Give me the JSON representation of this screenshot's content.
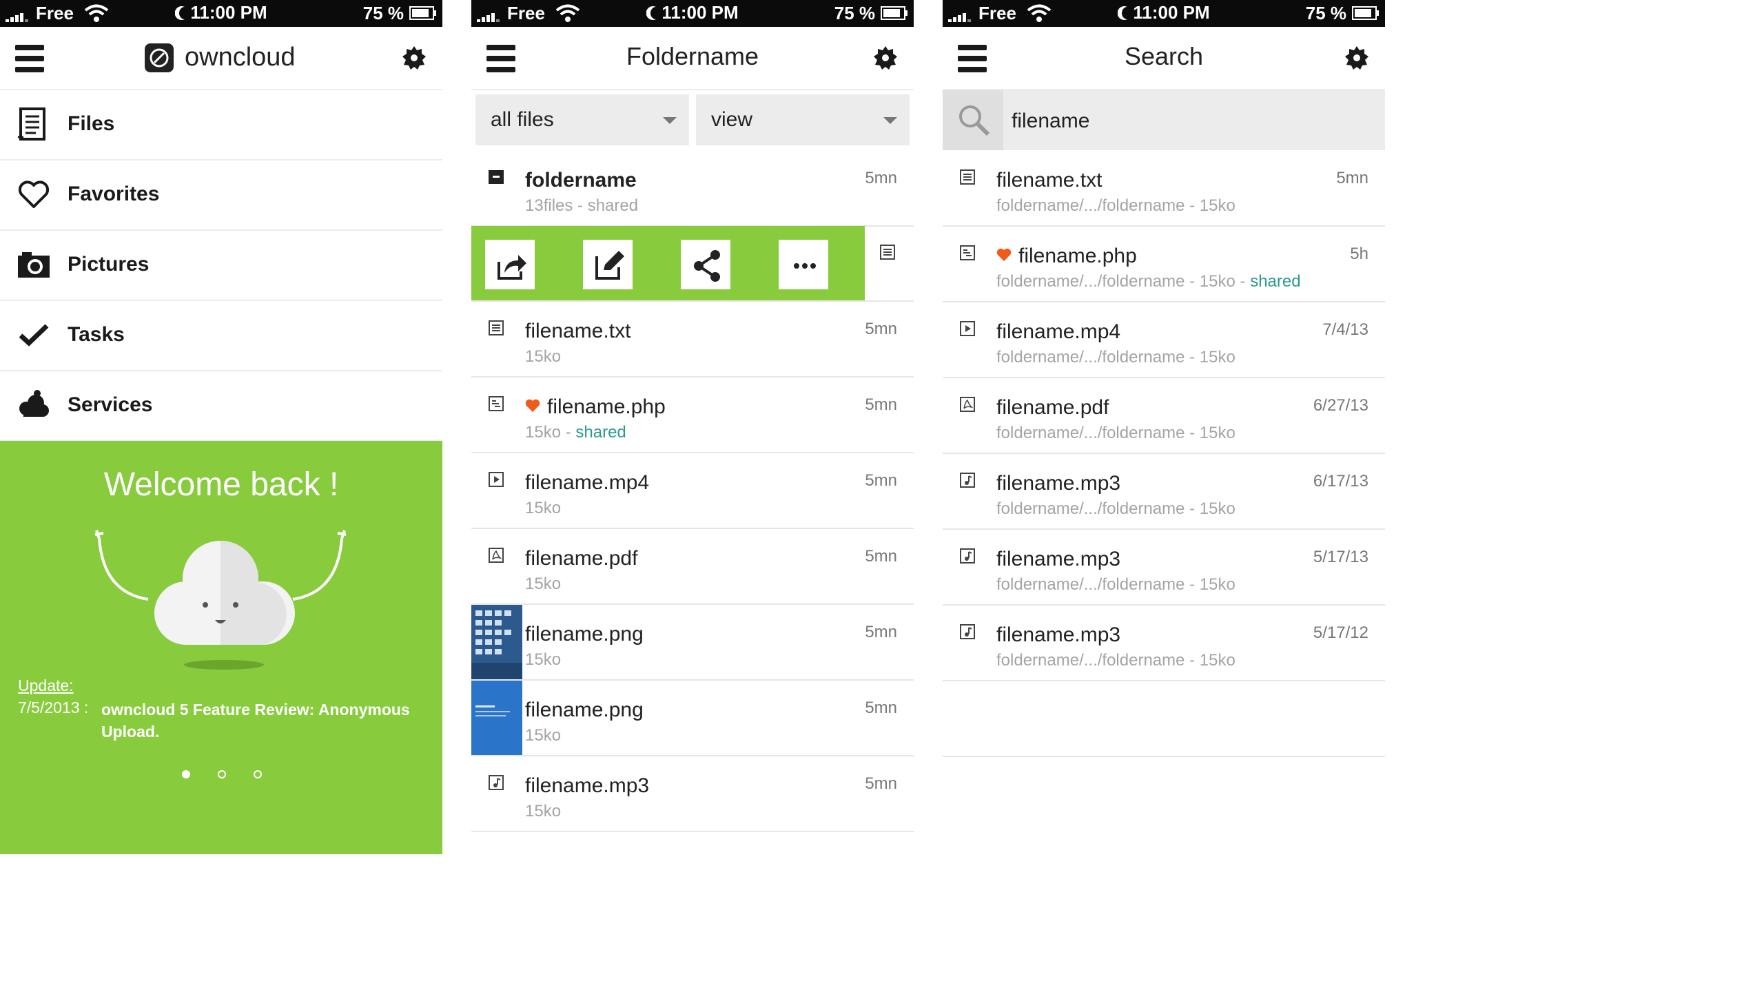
{
  "status_bar": {
    "carrier": "Free",
    "time": "11:00 PM",
    "battery": "75 %"
  },
  "screen1": {
    "logo_text": "owncloud",
    "nav": [
      {
        "label": "Files",
        "icon": "document-list-icon"
      },
      {
        "label": "Favorites",
        "icon": "heart-outline-icon"
      },
      {
        "label": "Pictures",
        "icon": "camera-icon"
      },
      {
        "label": "Tasks",
        "icon": "checkmark-icon"
      },
      {
        "label": "Services",
        "icon": "cloud-services-icon"
      }
    ],
    "welcome": {
      "title": "Welcome back !",
      "update_label": "Update:",
      "update_date": "7/5/2013 :",
      "update_text": "owncloud 5 Feature Review: Anonymous Upload.",
      "pages": 3,
      "active_page": 1
    }
  },
  "screen2": {
    "title": "Foldername",
    "filter": {
      "left": "all files",
      "right": "view"
    },
    "folder": {
      "name": "foldername",
      "meta": "13files - shared",
      "time": "5mn"
    },
    "actions": [
      "share-out-icon",
      "edit-icon",
      "share-icon",
      "more-icon"
    ],
    "files": [
      {
        "name": "filename.txt",
        "meta": "15ko",
        "shared": "",
        "time": "5mn",
        "icon": "text-file-icon"
      },
      {
        "name": "filename.php",
        "meta": "15ko - ",
        "shared": "shared",
        "time": "5mn",
        "icon": "code-file-icon",
        "favorite": true
      },
      {
        "name": "filename.mp4",
        "meta": "15ko",
        "shared": "",
        "time": "5mn",
        "icon": "video-file-icon"
      },
      {
        "name": "filename.pdf",
        "meta": "15ko",
        "shared": "",
        "time": "5mn",
        "icon": "pdf-file-icon"
      },
      {
        "name": "filename.png",
        "meta": "15ko",
        "shared": "",
        "time": "5mn",
        "icon": "image-thumbnail"
      },
      {
        "name": "filename.png",
        "meta": "15ko",
        "shared": "",
        "time": "5mn",
        "icon": "image-thumbnail"
      },
      {
        "name": "filename.mp3",
        "meta": "15ko",
        "shared": "",
        "time": "5mn",
        "icon": "audio-file-icon"
      }
    ]
  },
  "screen3": {
    "title": "Search",
    "search_value": "filename",
    "results": [
      {
        "name": "filename.txt",
        "meta": "foldername/.../foldername - 15ko",
        "shared": "",
        "time": "5mn",
        "icon": "text-file-icon"
      },
      {
        "name": "filename.php",
        "meta": "foldername/.../foldername - 15ko - ",
        "shared": "shared",
        "time": "5h",
        "icon": "code-file-icon",
        "favorite": true
      },
      {
        "name": "filename.mp4",
        "meta": "foldername/.../foldername - 15ko",
        "shared": "",
        "time": "7/4/13",
        "icon": "video-file-icon"
      },
      {
        "name": "filename.pdf",
        "meta": "foldername/.../foldername - 15ko",
        "shared": "",
        "time": "6/27/13",
        "icon": "pdf-file-icon"
      },
      {
        "name": "filename.mp3",
        "meta": "foldername/.../foldername - 15ko",
        "shared": "",
        "time": "6/17/13",
        "icon": "audio-file-icon"
      },
      {
        "name": "filename.mp3",
        "meta": "foldername/.../foldername - 15ko",
        "shared": "",
        "time": "5/17/13",
        "icon": "audio-file-icon"
      },
      {
        "name": "filename.mp3",
        "meta": "foldername/.../foldername - 15ko",
        "shared": "",
        "time": "5/17/12",
        "icon": "audio-file-icon"
      }
    ]
  },
  "colors": {
    "accent_green": "#88cc3e",
    "shared_teal": "#2c9a8e",
    "favorite_orange": "#f05a1a"
  }
}
